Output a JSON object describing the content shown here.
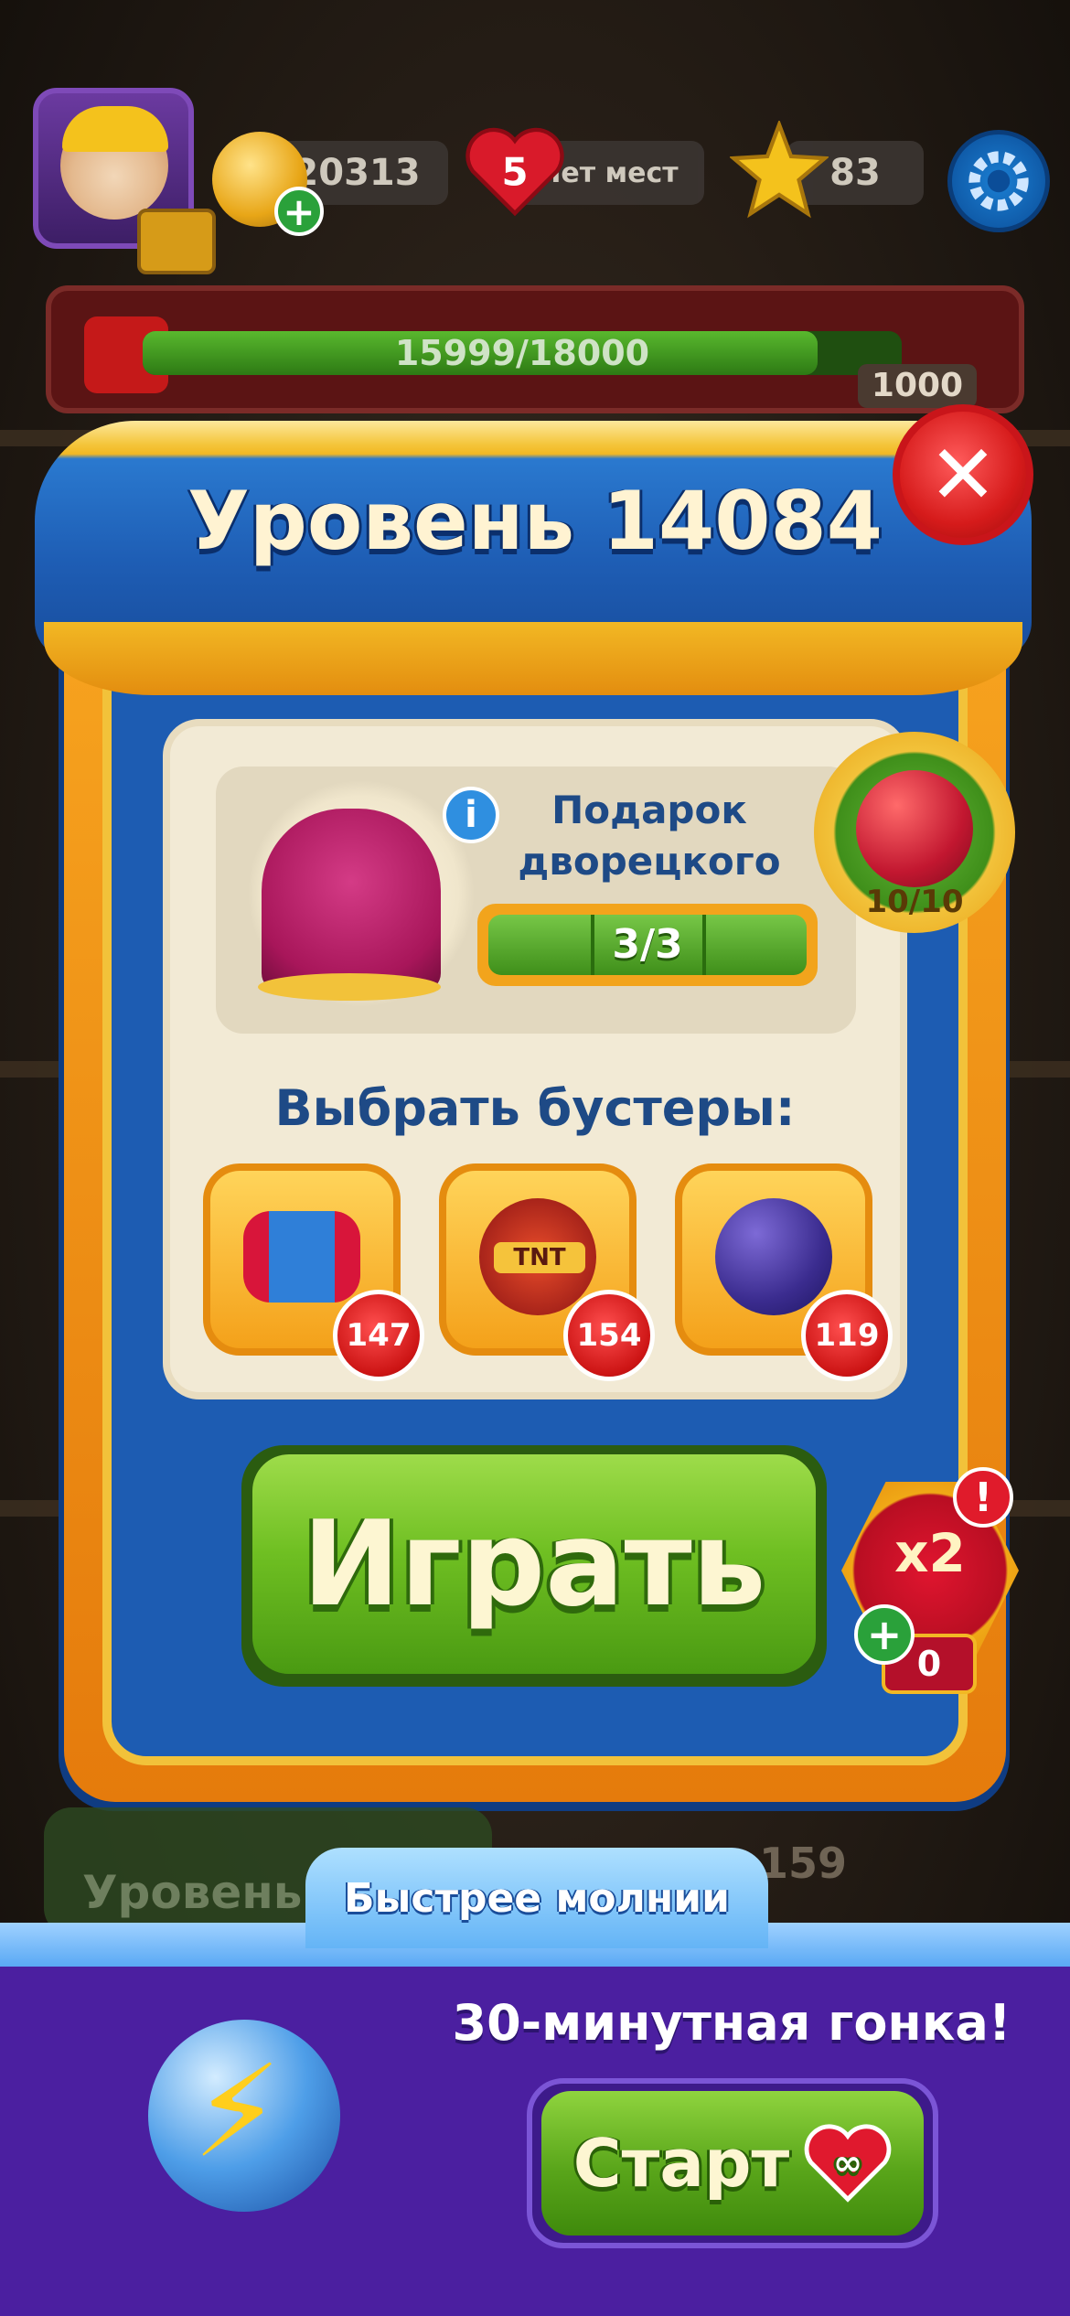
{
  "header": {
    "coins": "20313",
    "lives": "5",
    "lives_status": "Нет мест",
    "stars": "83"
  },
  "progress": {
    "text": "15999/18000",
    "value": 15999,
    "max": 18000,
    "reward": "1000"
  },
  "modal": {
    "title": "Уровень 14084",
    "gift": {
      "title_line1": "Подарок",
      "title_line2": "дворецкого",
      "progress": "3/3",
      "badge": "10/10"
    },
    "boosters_title": "Выбрать бустеры:",
    "boosters": [
      {
        "icon": "rocket-booster-icon",
        "count": "147"
      },
      {
        "icon": "tnt-barrel-icon",
        "count": "154"
      },
      {
        "icon": "light-ball-icon",
        "count": "119"
      }
    ],
    "play_label": "Играть",
    "x2": {
      "label": "x2",
      "count": "0"
    }
  },
  "under": {
    "level_label": "Уровень",
    "number": "159"
  },
  "event": {
    "tab_label": "Быстрее молнии",
    "headline": "30-минутная гонка!",
    "start_label": "Старт"
  },
  "colors": {
    "modal_blue": "#1d5cb2",
    "play_green": "#6fbf22",
    "close_red": "#d61b1b",
    "event_purple": "#4b1fa0"
  }
}
